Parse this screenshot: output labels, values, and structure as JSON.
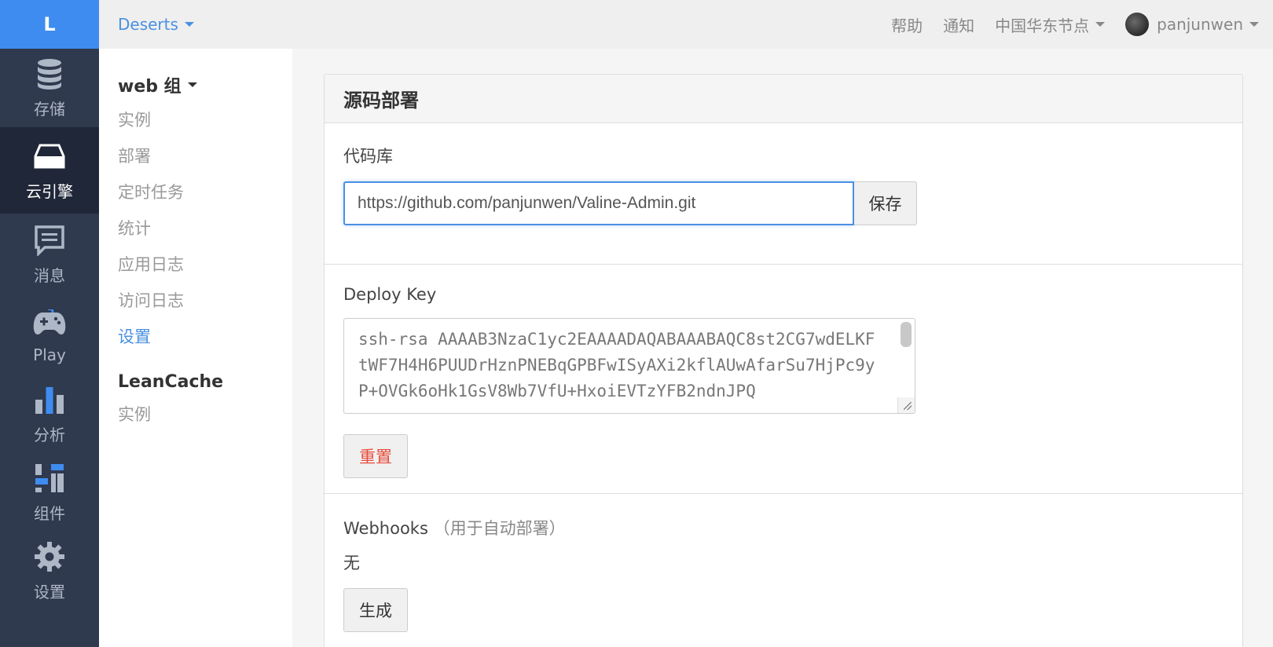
{
  "rail": {
    "logo": "L",
    "items": [
      {
        "label": "存储",
        "icon": "database-icon"
      },
      {
        "label": "云引擎",
        "icon": "server-icon",
        "active": true
      },
      {
        "label": "消息",
        "icon": "message-icon"
      },
      {
        "label": "Play",
        "icon": "gamepad-icon"
      },
      {
        "label": "分析",
        "icon": "bar-chart-icon"
      },
      {
        "label": "组件",
        "icon": "components-icon"
      },
      {
        "label": "设置",
        "icon": "gear-icon"
      }
    ]
  },
  "topbar": {
    "app_name": "Deserts",
    "help": "帮助",
    "notify": "通知",
    "region": "中国华东节点",
    "username": "panjunwen"
  },
  "subnav": {
    "group1_title": "web 组",
    "group1_items": [
      "实例",
      "部署",
      "定时任务",
      "统计",
      "应用日志",
      "访问日志",
      "设置"
    ],
    "group1_active": "设置",
    "group2_title": "LeanCache",
    "group2_items": [
      "实例"
    ]
  },
  "panel": {
    "title": "源码部署",
    "repo_label": "代码库",
    "repo_value": "https://github.com/panjunwen/Valine-Admin.git",
    "save_label": "保存",
    "deploy_key_label": "Deploy Key",
    "deploy_key_value": "ssh-rsa AAAAB3NzaC1yc2EAAAADAQABAAABAQC8st2CG7wdELKFtWF7H4H6PUUDrHznPNEBqGPBFwISyAXi2kflAUwAfarSu7HjPc9yP+OVGk6oHk1GsV8Wb7VfU+HxoiEVTzYFB2ndnJPQ",
    "reset_label": "重置",
    "webhooks_label": "Webhooks",
    "webhooks_hint": "（用于自动部署）",
    "webhooks_value": "无",
    "generate_label": "生成"
  },
  "colors": {
    "rail_bg": "#2f3a4f",
    "rail_active": "#1f2738",
    "logo_bg": "#3f8cf0",
    "accent": "#4a90e2",
    "danger": "#e74c3c"
  }
}
